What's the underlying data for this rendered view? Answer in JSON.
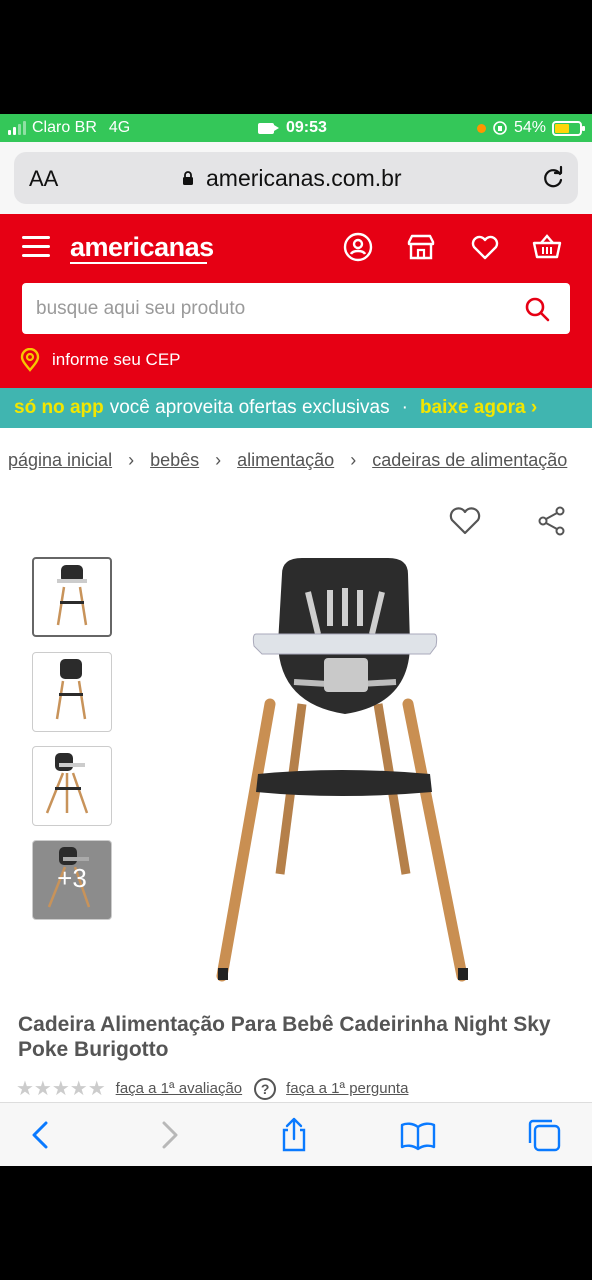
{
  "status_bar": {
    "carrier": "Claro BR",
    "network": "4G",
    "time": "09:53",
    "battery": "54%"
  },
  "browser": {
    "text_size_label": "AA",
    "url": "americanas.com.br"
  },
  "header": {
    "logo": "americanas",
    "search": {
      "placeholder": "busque aqui seu produto"
    },
    "cep_label": "informe seu CEP"
  },
  "promo": {
    "part1": "só no app",
    "part2": "você aproveita ofertas exclusivas",
    "dot": "·",
    "cta": "baixe agora ›"
  },
  "breadcrumb": [
    "página inicial",
    "bebês",
    "alimentação",
    "cadeiras de alimentação"
  ],
  "breadcrumb_sep": "›",
  "gallery": {
    "more_count": "+3"
  },
  "product": {
    "title": "Cadeira Alimentação Para Bebê Cadeirinha Night Sky Poke Burigotto",
    "rating_stars": "★★★★★",
    "review_link": "faça a 1ª avaliação",
    "question_link": "faça a 1ª pergunta"
  },
  "colors": {
    "brand_red": "#e60014",
    "promo_teal": "#40b5b0",
    "promo_yellow": "#f2e600",
    "status_green": "#34c759"
  }
}
